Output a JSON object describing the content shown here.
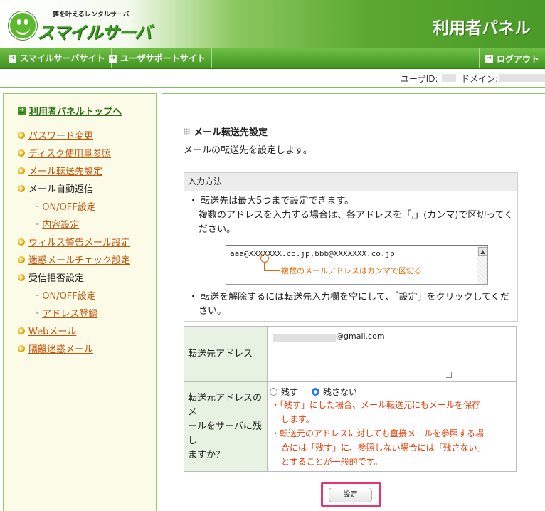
{
  "header": {
    "logo_tagline": "夢を叶えるレンタルサーバ",
    "logo_name": "スマイルサーバ",
    "panel_title": "利用者パネル"
  },
  "nav": {
    "items": [
      {
        "label": "スマイルサーバサイト",
        "icon": "arrow-right-icon"
      },
      {
        "label": "ユーザサポートサイト",
        "icon": "arrow-right-icon"
      }
    ],
    "logout": "ログアウト"
  },
  "user": {
    "id_label": "ユーザID:",
    "domain_label": "ドメイン:"
  },
  "sidebar": {
    "top_link": "利用者パネルトップへ",
    "items": [
      {
        "label": "パスワード変更",
        "type": "link"
      },
      {
        "label": "ディスク使用量参照",
        "type": "link"
      },
      {
        "label": "メール転送先設定",
        "type": "link"
      },
      {
        "label": "メール自動返信",
        "type": "text"
      },
      {
        "label": "ON/OFF設定",
        "type": "sublink"
      },
      {
        "label": "内容設定",
        "type": "sublink"
      },
      {
        "label": "ウィルス警告メール設定",
        "type": "link"
      },
      {
        "label": "迷惑メールチェック設定",
        "type": "link"
      },
      {
        "label": "受信拒否設定",
        "type": "text"
      },
      {
        "label": "ON/OFF設定",
        "type": "sublink"
      },
      {
        "label": "アドレス登録",
        "type": "sublink"
      },
      {
        "label": "Webメール",
        "type": "link"
      },
      {
        "label": "隔離迷惑メール",
        "type": "link"
      }
    ]
  },
  "main": {
    "section_title": "メール転送先設定",
    "section_desc": "メールの転送先を設定します。",
    "howto": {
      "header": "入力方法",
      "line1": "・ 転送先は最大5つまで設定できます。",
      "line2": "複数のアドレスを入力する場合は、各アドレスを「,」(カンマ)で区切ってく",
      "line3": "ださい。",
      "example": "aaa@XXXXXXX.co.jp,bbb@XXXXXXX.co.jp",
      "callout": "複数のメールアドレスはカンマで区切る",
      "line4": "・ 転送を解除するには転送先入力欄を空にして、「設定」をクリックしてくだ",
      "line5": "さい。"
    },
    "form": {
      "forward_label": "転送先アドレス",
      "forward_value": "@gmail.com",
      "keep_label_1": "転送元アドレスのメ",
      "keep_label_2": "ールをサーバに残し",
      "keep_label_3": "ますか？",
      "option_keep": "残す",
      "option_delete": "残さない",
      "selected": "残さない",
      "note1_a": "・「残す」にした場合、メール転送元にもメールを保存",
      "note1_b": "します。",
      "note2_a": "・転送元のアドレスに対しても直接メールを参照する場",
      "note2_b": "合には「残す」に、参照しない場合には「残さない」",
      "note2_c": "とすることが一般的です。"
    },
    "submit": "設定"
  },
  "colors": {
    "brand_green": "#4a9a28",
    "link_orange": "#c0560b",
    "note_red": "#e8400c",
    "highlight_pink": "#e8336d"
  }
}
